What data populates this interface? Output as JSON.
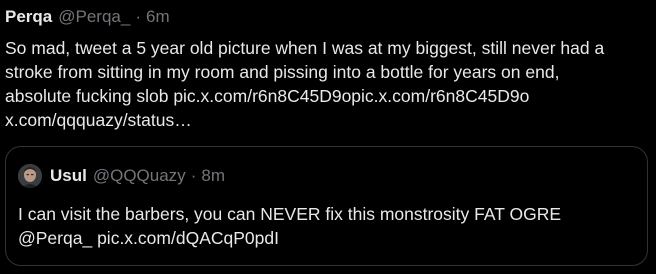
{
  "tweet": {
    "author_name": "Perqa",
    "handle": "@Perqa_",
    "separator": "·",
    "time": "6m",
    "text_line_1": "So mad, tweet a 5 year old picture when I was at my biggest, still never had a",
    "text_line_2": "stroke from sitting in my room and pissing into a bottle for years on end,",
    "text_line_3_prefix": "absolute fucking slob ",
    "link_1": "pic.x.com/r6n8C45D9opic.x.com/r6n8C45D9o",
    "link_2": "x.com/qqquazy/status…"
  },
  "quote": {
    "author_name": "Usul",
    "handle": "@QQQuazy",
    "separator": "·",
    "time": "8m",
    "text_line_1": "I can visit the barbers, you can NEVER fix this monstrosity FAT OGRE",
    "mention": "@Perqa_",
    "link": "pic.x.com/dQACqP0pdI"
  },
  "colors": {
    "background": "#000000",
    "text_primary": "#e7e9ea",
    "text_secondary": "#71767b",
    "card_border": "#2f3336"
  },
  "icons": {
    "avatar": "user-avatar-image"
  }
}
